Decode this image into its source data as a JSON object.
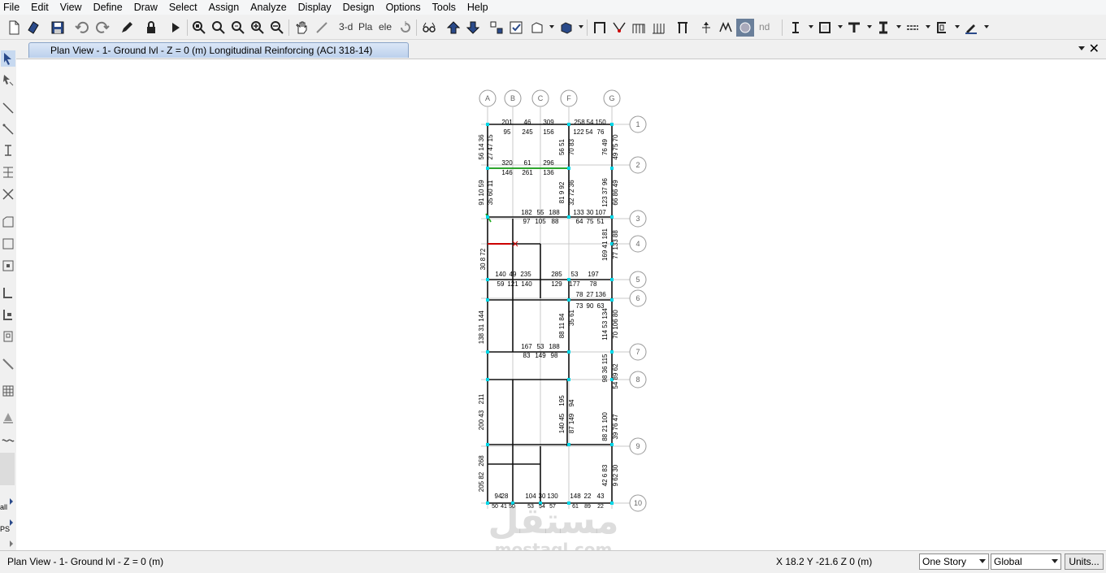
{
  "menu": [
    "File",
    "Edit",
    "View",
    "Define",
    "Draw",
    "Select",
    "Assign",
    "Analyze",
    "Display",
    "Design",
    "Options",
    "Tools",
    "Help"
  ],
  "toolbar": {
    "three_d_label": "3-d",
    "plan_label": "Pla",
    "elev_label": "ele",
    "nd_label": "nd"
  },
  "left_toolbar": {
    "all_label": "all",
    "ps_label": "PS"
  },
  "tab": {
    "title": "Plan View - 1- Ground lvl - Z = 0 (m)  Longitudinal Reinforcing  (ACI 318-14)"
  },
  "grid": {
    "columns": [
      "A",
      "B",
      "C",
      "F",
      "G"
    ],
    "rows": [
      "1",
      "2",
      "3",
      "4",
      "5",
      "6",
      "7",
      "8",
      "9",
      "10"
    ]
  },
  "reinforcing_labels": {
    "top_values": [
      "201",
      "46",
      "309",
      "258",
      "54",
      "150"
    ],
    "strip_1": [
      "95",
      "245",
      "156",
      "122",
      "54",
      "76"
    ],
    "strip_2": [
      "320",
      "61",
      "296",
      "146",
      "261",
      "136"
    ],
    "strip_3": [
      "182",
      "55",
      "188",
      "133",
      "30",
      "107"
    ],
    "strip_4": [
      "97",
      "105",
      "88",
      "64",
      "75",
      "51"
    ],
    "strip_5": [
      "140",
      "49",
      "235",
      "285",
      "53",
      "197"
    ],
    "strip_6": [
      "59",
      "121",
      "140",
      "129",
      "177",
      "78"
    ],
    "strip_7": [
      "78",
      "27",
      "136",
      "73",
      "90",
      "63"
    ],
    "strip_8": [
      "167",
      "53",
      "188",
      "83",
      "149",
      "98"
    ],
    "strip_9": [
      "94",
      "28",
      "104",
      "30",
      "130",
      "148",
      "22",
      "43"
    ],
    "bottom_values": [
      "50",
      "41",
      "50",
      "53",
      "54",
      "57",
      "61",
      "89",
      "22"
    ],
    "vertical_left": [
      "56 14 36",
      "27 47 15",
      "91 10 59",
      "35 60 11",
      "30 8 72",
      "144",
      "138 31",
      "211",
      "200 43",
      "268",
      "205 82"
    ],
    "vertical_mid": [
      "56 51",
      "70 83",
      "81 9 92",
      "32 72 36",
      "35 61",
      "88 11 84",
      "195",
      "140 45",
      "94",
      "87 149"
    ],
    "vertical_right": [
      "49 75 70",
      "76 49",
      "66 86 49",
      "123 37 96",
      "77 133 88",
      "169 41 181",
      "70 106 80",
      "114 53 134",
      "54 89 62",
      "98 36 115",
      "39 76 47",
      "88 21 100",
      "9 62 30",
      "42 6 83"
    ]
  },
  "status": {
    "view": "Plan View - 1- Ground lvl - Z = 0 (m)",
    "coords": "X 18.2  Y -21.6  Z 0 (m)",
    "story_select": "One Story",
    "coord_system": "Global",
    "units_button": "Units..."
  },
  "watermark": {
    "arabic": "مستقل",
    "latin": "mostaql.com"
  },
  "colors": {
    "accent_tab": "#bcd0ec",
    "support_marker": "#00d8e8",
    "selected_beam": "#cc0000",
    "highlight_beam": "#22aa22"
  }
}
